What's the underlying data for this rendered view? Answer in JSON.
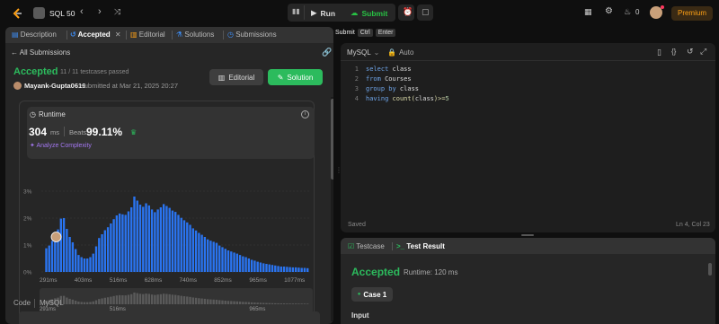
{
  "nav": {
    "problem_list_title": "SQL 50",
    "run_label": "Run",
    "submit_label": "Submit",
    "streak_count": "0",
    "premium_label": "Premium"
  },
  "tabs": [
    {
      "label": "Description",
      "icon": "description-icon"
    },
    {
      "label": "Accepted",
      "icon": "history-icon",
      "active": true
    },
    {
      "label": "Editorial",
      "icon": "book-icon"
    },
    {
      "label": "Solutions",
      "icon": "flask-icon"
    },
    {
      "label": "Submissions",
      "icon": "clock-icon"
    }
  ],
  "submission": {
    "back_label": "All Submissions",
    "status": "Accepted",
    "testcases": "11 / 11 testcases passed",
    "user": "Mayank-Gupta0619",
    "submitted_at": "submitted at Mar 21, 2025 20:27",
    "editorial_btn": "Editorial",
    "solution_btn": "Solution"
  },
  "runtime": {
    "label": "Runtime",
    "value": "304",
    "unit": "ms",
    "beats_label": "Beats",
    "beats_value": "99.11%",
    "analyze_label": "Analyze Complexity"
  },
  "chart_data": {
    "type": "bar",
    "yticks": [
      "3%",
      "2%",
      "1%",
      "0%"
    ],
    "ylim": [
      0,
      3
    ],
    "xticks": [
      "291ms",
      "403ms",
      "516ms",
      "628ms",
      "740ms",
      "852ms",
      "965ms",
      "1077ms"
    ],
    "xlim": [
      291,
      1140
    ],
    "highlight_x": 304,
    "values": [
      0.88,
      0.98,
      1.15,
      1.42,
      1.58,
      1.98,
      2.0,
      1.6,
      1.3,
      1.1,
      0.85,
      0.63,
      0.55,
      0.5,
      0.5,
      0.55,
      0.68,
      0.95,
      1.26,
      1.4,
      1.55,
      1.66,
      1.8,
      1.96,
      2.1,
      2.17,
      2.14,
      2.12,
      2.25,
      2.4,
      2.8,
      2.65,
      2.5,
      2.42,
      2.55,
      2.47,
      2.32,
      2.22,
      2.32,
      2.4,
      2.52,
      2.45,
      2.38,
      2.28,
      2.23,
      2.12,
      2.01,
      1.92,
      1.84,
      1.75,
      1.62,
      1.54,
      1.45,
      1.38,
      1.3,
      1.21,
      1.16,
      1.12,
      1.08,
      0.98,
      0.92,
      0.86,
      0.8,
      0.76,
      0.72,
      0.68,
      0.63,
      0.58,
      0.55,
      0.5,
      0.45,
      0.42,
      0.38,
      0.35,
      0.32,
      0.3,
      0.28,
      0.26,
      0.24,
      0.22,
      0.2,
      0.2,
      0.19,
      0.18,
      0.17,
      0.17,
      0.16,
      0.15,
      0.15,
      0.14
    ],
    "navigator_ticks": [
      "291ms",
      "516ms",
      "965ms"
    ]
  },
  "code_section": {
    "label": "Code",
    "lang": "MySQL"
  },
  "editor": {
    "submit_tip": [
      "Submit",
      "Ctrl",
      "Enter"
    ],
    "language": "MySQL",
    "mode": "Auto",
    "lines": [
      [
        {
          "t": "select",
          "c": "kw"
        },
        {
          "t": " class",
          "c": "id"
        }
      ],
      [
        {
          "t": "from",
          "c": "kw"
        },
        {
          "t": " Courses",
          "c": "id"
        }
      ],
      [
        {
          "t": "group by",
          "c": "kw"
        },
        {
          "t": " class",
          "c": "id"
        }
      ],
      [
        {
          "t": "having",
          "c": "kw"
        },
        {
          "t": " count(",
          "c": "fn"
        },
        {
          "t": "class",
          "c": "id"
        },
        {
          "t": ")>=",
          "c": "fn"
        },
        {
          "t": "5",
          "c": "num"
        }
      ]
    ],
    "saved_label": "Saved",
    "cursor_pos": "Ln 4, Col 23"
  },
  "result": {
    "testcase_tab": "Testcase",
    "result_tab": "Test Result",
    "status": "Accepted",
    "runtime": "Runtime: 120 ms",
    "case_label": "Case 1",
    "input_label": "Input"
  },
  "colors": {
    "accent_green": "#2cbb5d",
    "bar_blue": "#2a74f0",
    "premium_orange": "#ffa116",
    "analyze_purple": "#a377f0"
  }
}
